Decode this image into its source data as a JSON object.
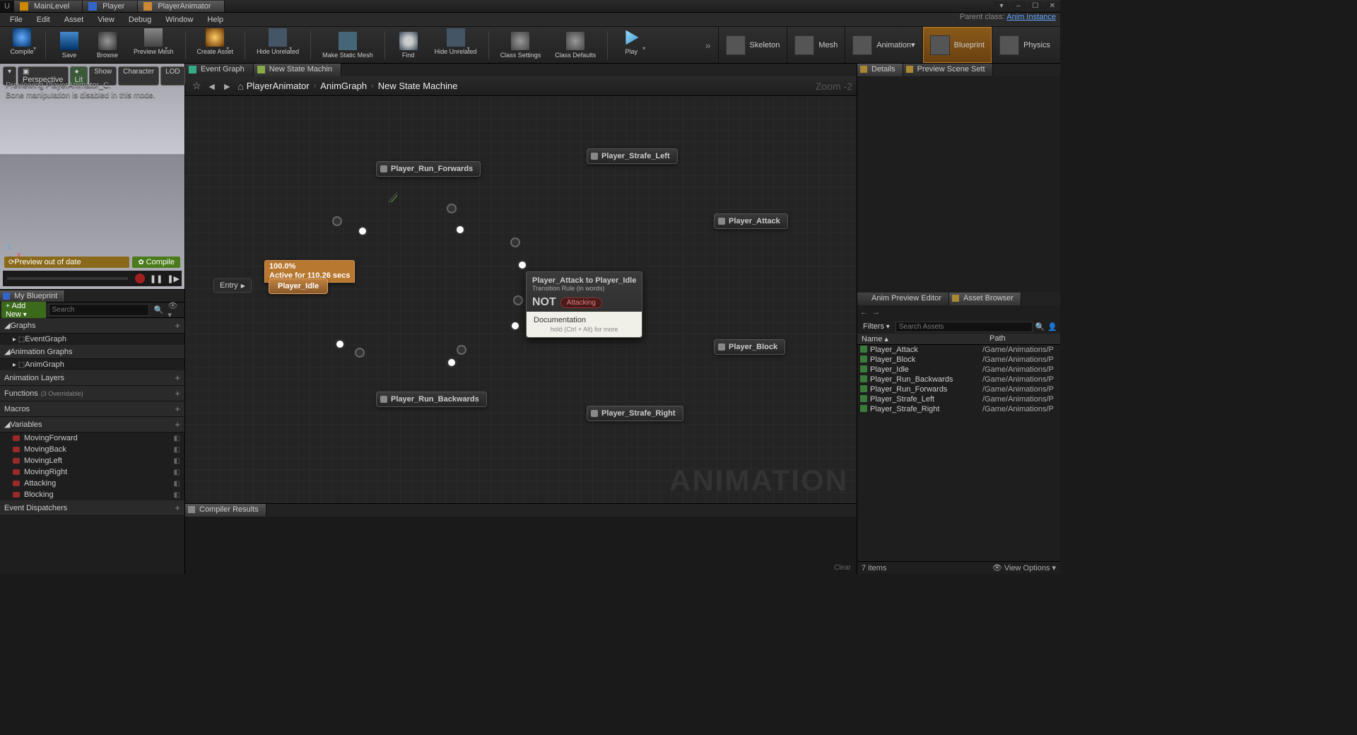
{
  "window": {
    "tabs": [
      "MainLevel",
      "Player",
      "PlayerAnimator"
    ],
    "active_tab": 2,
    "parent_class_label": "Parent class:",
    "parent_class": "Anim Instance"
  },
  "menubar": [
    "File",
    "Edit",
    "Asset",
    "View",
    "Debug",
    "Window",
    "Help"
  ],
  "toolbar": [
    {
      "label": "Compile",
      "dropdown": true
    },
    {
      "divider": true
    },
    {
      "label": "Save"
    },
    {
      "label": "Browse"
    },
    {
      "label": "Preview Mesh",
      "dropdown": true
    },
    {
      "divider": true
    },
    {
      "label": "Create Asset",
      "dropdown": true
    },
    {
      "divider": true
    },
    {
      "label": "Hide Unrelated",
      "dropdown": true
    },
    {
      "divider": true
    },
    {
      "label": "Make Static Mesh"
    },
    {
      "divider": true
    },
    {
      "label": "Find"
    },
    {
      "label": "Hide Unrelated",
      "dropdown": true
    },
    {
      "divider": true
    },
    {
      "label": "Class Settings"
    },
    {
      "label": "Class Defaults"
    },
    {
      "divider": true
    },
    {
      "label": "Play",
      "dropdown": true
    }
  ],
  "mode_tabs": [
    {
      "label": "Skeleton"
    },
    {
      "label": "Mesh"
    },
    {
      "label": "Animation",
      "dropdown": true
    },
    {
      "label": "Blueprint",
      "active": true
    },
    {
      "label": "Physics"
    }
  ],
  "viewport": {
    "pills": [
      "",
      "Perspective",
      "Lit",
      "Show",
      "Character",
      "LOD"
    ],
    "preview_note_l1": "Previewing PlayerAnimator_C.",
    "preview_note_l2": "Bone manipulation is disabled in this mode.",
    "status": "Preview out of date",
    "compile": "Compile",
    "axis_x": "x",
    "axis_z": "z"
  },
  "my_blueprint": {
    "tab": "My Blueprint",
    "add_new": "Add New",
    "search_ph": "Search",
    "sections": {
      "graphs": "Graphs",
      "eventgraph": "EventGraph",
      "anim_graphs": "Animation Graphs",
      "animgraph": "AnimGraph",
      "anim_layers": "Animation Layers",
      "functions": "Functions",
      "functions_sub": "(3 Overridable)",
      "macros": "Macros",
      "variables": "Variables",
      "event_dispatchers": "Event Dispatchers"
    },
    "variables": [
      "MovingForward",
      "MovingBack",
      "MovingLeft",
      "MovingRight",
      "Attacking",
      "Blocking"
    ]
  },
  "graph": {
    "tabs": [
      {
        "label": "Event Graph"
      },
      {
        "label": "New State Machin",
        "active": true
      }
    ],
    "breadcrumb": [
      "PlayerAnimator",
      "AnimGraph",
      "New State Machine"
    ],
    "zoom": "Zoom  -2",
    "watermark": "ANIMATION",
    "entry": "Entry",
    "nodes": {
      "idle": "Player_Idle",
      "idle_badge_l1": "100.0%",
      "idle_badge_l2": "Active for 110.26 secs",
      "run_fwd": "Player_Run_Forwards",
      "run_bwd": "Player_Run_Backwards",
      "strafe_l": "Player_Strafe_Left",
      "strafe_r": "Player_Strafe_Right",
      "attack": "Player_Attack",
      "block": "Player_Block"
    },
    "tooltip": {
      "title": "Player_Attack to Player_Idle",
      "subtitle": "Transition Rule (in words)",
      "not": "NOT",
      "badge": "Attacking",
      "doc_title": "Documentation",
      "doc_hint": "hold (Ctrl + Alt) for more"
    }
  },
  "compiler": {
    "tab": "Compiler Results",
    "clear": "Clear"
  },
  "right": {
    "top_tabs": [
      "Details",
      "Preview Scene Sett"
    ],
    "bottom_tabs": [
      "Anim Preview Editor",
      "Asset Browser"
    ],
    "active_bottom": 1,
    "filters": "Filters",
    "search_ph": "Search Assets",
    "columns": {
      "name": "Name",
      "path": "Path"
    },
    "assets": [
      {
        "name": "Player_Attack",
        "path": "/Game/Animations/P"
      },
      {
        "name": "Player_Block",
        "path": "/Game/Animations/P"
      },
      {
        "name": "Player_Idle",
        "path": "/Game/Animations/P"
      },
      {
        "name": "Player_Run_Backwards",
        "path": "/Game/Animations/P"
      },
      {
        "name": "Player_Run_Forwards",
        "path": "/Game/Animations/P"
      },
      {
        "name": "Player_Strafe_Left",
        "path": "/Game/Animations/P"
      },
      {
        "name": "Player_Strafe_Right",
        "path": "/Game/Animations/P"
      }
    ],
    "footer_count": "7 items",
    "view_options": "View Options"
  }
}
